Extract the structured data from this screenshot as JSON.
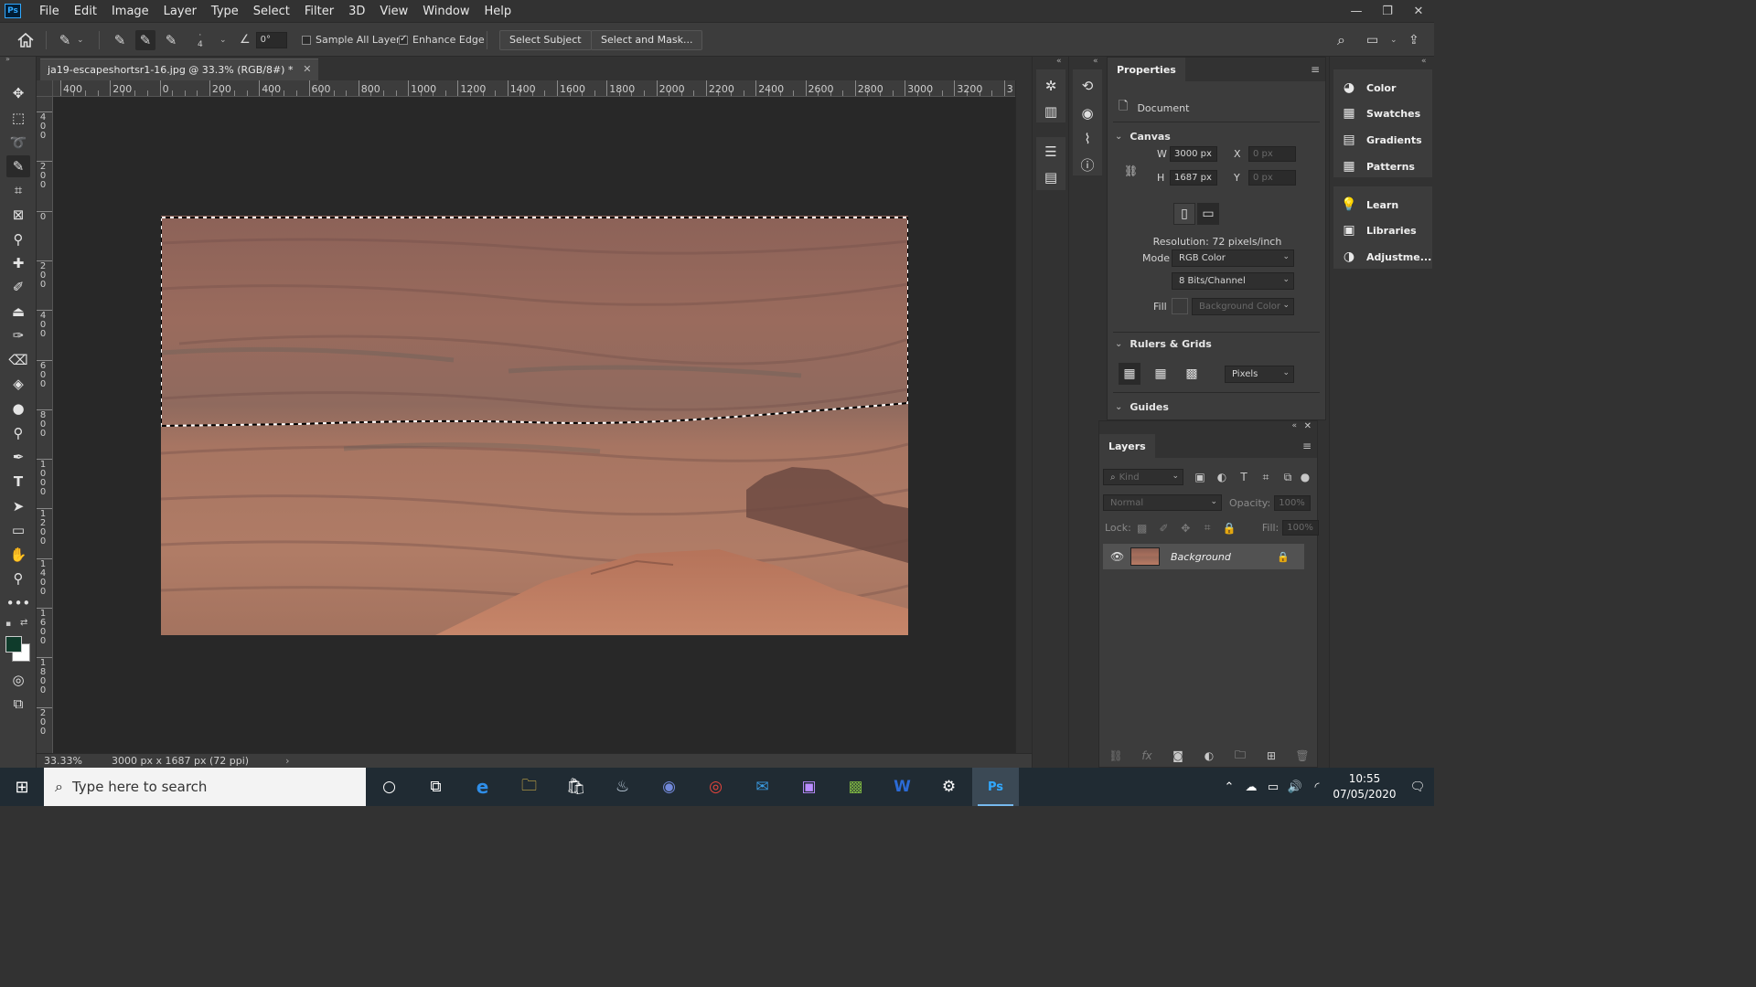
{
  "app": {
    "logo": "Ps"
  },
  "menu": [
    "File",
    "Edit",
    "Image",
    "Layer",
    "Type",
    "Select",
    "Filter",
    "3D",
    "View",
    "Window",
    "Help"
  ],
  "window_controls": {
    "minimize": "—",
    "restore": "❐",
    "close": "✕"
  },
  "options": {
    "brush_size": "4",
    "angle": "0°",
    "sample_all_layers": "Sample All Layers",
    "sample_all_layers_checked": false,
    "enhance_edge": "Enhance Edge",
    "enhance_edge_checked": true,
    "select_subject": "Select Subject",
    "select_and_mask": "Select and Mask..."
  },
  "document": {
    "tab_title": "ja19-escapeshortsr1-16.jpg @ 33.3% (RGB/8#) *",
    "zoom": "33.33%",
    "doc_info": "3000 px x 1687 px (72 ppi)"
  },
  "ruler": {
    "h_labels": [
      "400",
      "200",
      "0",
      "200",
      "400",
      "600",
      "800",
      "1000",
      "1200",
      "1400",
      "1600",
      "1800",
      "2000",
      "2200",
      "2400",
      "2600",
      "2800",
      "3000",
      "3200",
      "3"
    ],
    "v_labels": [
      "400",
      "200",
      "0",
      "200",
      "400",
      "600",
      "800",
      "1000",
      "1200",
      "1400",
      "1600",
      "1800",
      "200"
    ]
  },
  "properties": {
    "title": "Properties",
    "kind": "Document",
    "canvas_section": "Canvas",
    "w_label": "W",
    "w_value": "3000 px",
    "h_label": "H",
    "h_value": "1687 px",
    "x_label": "X",
    "x_value": "0 px",
    "y_label": "Y",
    "y_value": "0 px",
    "resolution": "Resolution: 72 pixels/inch",
    "mode_label": "Mode",
    "mode_value": "RGB Color",
    "bits_value": "8 Bits/Channel",
    "fill_label": "Fill",
    "fill_value": "Background Color",
    "rulers_section": "Rulers & Grids",
    "units_value": "Pixels",
    "guides_section": "Guides"
  },
  "layers": {
    "title": "Layers",
    "kind_placeholder": "Kind",
    "blend_mode": "Normal",
    "opacity_label": "Opacity:",
    "opacity_value": "100%",
    "lock_label": "Lock:",
    "fill_label": "Fill:",
    "fill_value": "100%",
    "items": [
      {
        "name": "Background",
        "visible": true,
        "locked": true
      }
    ]
  },
  "dock": {
    "items": [
      "Color",
      "Swatches",
      "Gradients",
      "Patterns",
      "Learn",
      "Libraries",
      "Adjustme..."
    ]
  },
  "taskbar": {
    "search_placeholder": "Type here to search",
    "time": "10:55",
    "date": "07/05/2020"
  },
  "colors": {
    "foreground": "#0f3b2b",
    "background": "#ffffff",
    "accent": "#31a8ff"
  }
}
